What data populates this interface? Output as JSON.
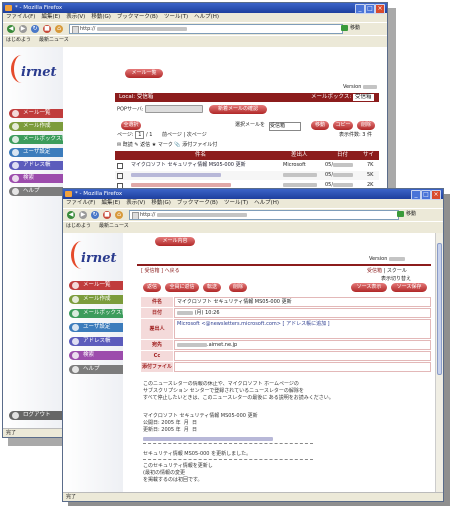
{
  "back_window": {
    "title": "* - Mozilla Firefox",
    "menu": [
      "ファイル(F)",
      "編集(E)",
      "表示(V)",
      "移動(G)",
      "ブックマーク(B)",
      "ツール(T)",
      "ヘルプ(H)"
    ],
    "url": "http://",
    "go_label": "移動",
    "bookmarks": [
      "はじめよう",
      "最新ニュース"
    ],
    "logo_text": "irnet",
    "sidebar": [
      "メール一覧",
      "メール作成",
      "メールボックス管理",
      "ユーザ設定",
      "アドレス帳",
      "検索",
      "ヘルプ"
    ],
    "tab_label": "メール一覧",
    "version_label": "Version",
    "folder_bar": {
      "left": "Local: 受信箱",
      "right": "メールボックス:",
      "selected_box": "受信箱"
    },
    "pop_label": "POPサーバ:",
    "check_new_button": "新着メールの確認",
    "all_select": "全選択",
    "move_label": "選択メールを",
    "move_target": "受信箱",
    "move_button": "移動",
    "copy_button": "コピー",
    "delete_button": "削除",
    "display_count": "表示件数: 3 件",
    "page_label": "ページ:",
    "page_value": "1",
    "page_total": "/ 1",
    "page_nav": "前ページ | 次ページ",
    "markers": [
      "✉ 既読",
      "✎ 返信",
      "★ マーク",
      "📎 添付ファイル付"
    ],
    "columns": [
      "件名",
      "差出人",
      "日付",
      "サイズ"
    ],
    "rows": [
      {
        "subject": "マイクロソフト セキュリティ情報 MS05-000 更新",
        "from": "Microsoft",
        "date": "05/",
        "size": "7K"
      },
      {
        "subject": "",
        "from": "",
        "date": "05/",
        "size": "5K"
      },
      {
        "subject": "",
        "from": "",
        "date": "05/",
        "size": "2K"
      }
    ],
    "side_footer": "ログアウト",
    "status": "完了"
  },
  "front_window": {
    "title": "* - Mozilla Firefox",
    "menu": [
      "ファイル(F)",
      "編集(E)",
      "表示(V)",
      "移動(G)",
      "ブックマーク(B)",
      "ツール(T)",
      "ヘルプ(H)"
    ],
    "url": "http://",
    "go_label": "移動",
    "bookmarks": [
      "はじめよう",
      "最新ニュース"
    ],
    "logo_text": "irnet",
    "sidebar": [
      "メール一覧",
      "メール作成",
      "メールボックス管理",
      "ユーザ設定",
      "アドレス帳",
      "検索",
      "ヘルプ"
    ],
    "tab_label": "メール内容",
    "version_label": "Version",
    "back_link": "[ 受信箱 ] へ戻る",
    "right_links": [
      "受信箱",
      "| スクール",
      "表示切り替え"
    ],
    "action_buttons": [
      "返信",
      "全員に返信",
      "転送",
      "削除"
    ],
    "source_buttons": [
      "ソース表示",
      "ソース保存"
    ],
    "header_labels": [
      "件名",
      "日付",
      "差出人",
      "宛先",
      "Cc",
      "添付ファイル"
    ],
    "header_values": {
      "subject": "マイクロソフト セキュリティ情報 MS05-000 更新",
      "date": "(月) 10:26",
      "from": "Microsoft <@newsletters.microsoft.com> [ アドレス帳に追加 ]",
      "to": ".airnet.ne.jp",
      "cc": "",
      "attach": ""
    },
    "body_lines": [
      "このニュースレターの情報の休止や、マイクロソフト ホームページの",
      "サブスクリプション センターで登録されているニュースレターの解除を",
      "すべて停止したいときは、このニュースレターの最後に ある説明をお読みください。",
      "",
      "マイクロソフト セキュリティ情報 MS05-000 更新",
      "公開日: 2005 年  月  日",
      "更新日: 2005 年  月  日",
      "",
      "",
      "セキュリティ情報 MS05-000 を更新しました。",
      "",
      "このセキュリティ情報を更新し",
      "(最初の情報の変更",
      "を掲載するのは初回です。"
    ],
    "status": "完了"
  }
}
